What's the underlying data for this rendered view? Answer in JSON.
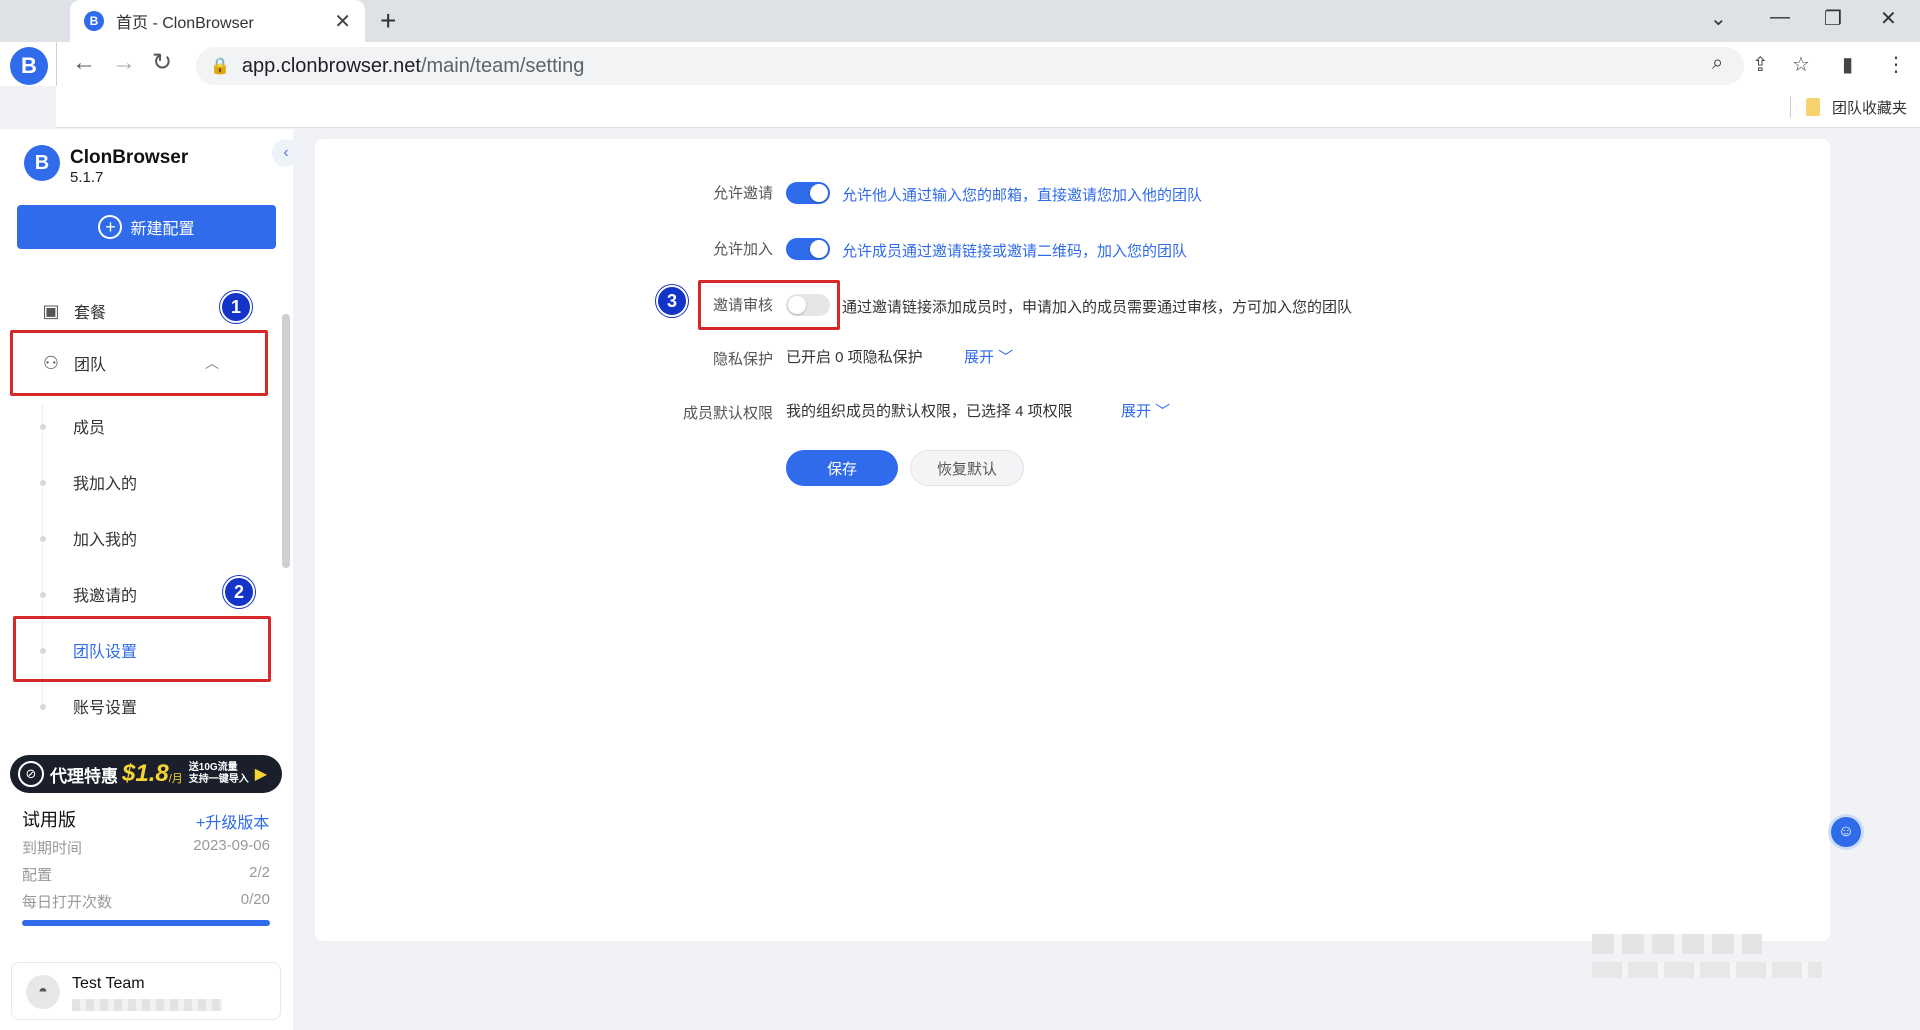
{
  "browser": {
    "tab_title": "首页 - ClonBrowser",
    "tab_close": "✕",
    "new_tab": "+",
    "url_host": "app.clonbrowser.net",
    "url_path": "/main/team/setting",
    "bookmark": "团队收藏夹"
  },
  "sidebar": {
    "brand": "ClonBrowser",
    "version": "5.1.7",
    "new_config": "新建配置",
    "items": {
      "plan": "套餐",
      "team": "团队"
    },
    "team_children": [
      "成员",
      "我加入的",
      "加入我的",
      "我邀请的",
      "团队设置",
      "账号设置"
    ],
    "promo": {
      "label": "代理特惠",
      "price": "$1.8",
      "unit": "/月",
      "sub1": "送10G流量",
      "sub2": "支持一键导入"
    },
    "plan_info": {
      "title": "试用版",
      "upgrade": "+升级版本",
      "rows": [
        {
          "label": "到期时间",
          "value": "2023-09-06"
        },
        {
          "label": "配置",
          "value": "2/2"
        },
        {
          "label": "每日打开次数",
          "value": "0/20"
        }
      ],
      "progress": 1.0
    },
    "account_name": "Test Team"
  },
  "annotations": [
    "1",
    "2",
    "3"
  ],
  "settings": {
    "allow_invite": {
      "label": "允许邀请",
      "enabled": true,
      "desc": "允许他人通过输入您的邮箱，直接邀请您加入他的团队"
    },
    "allow_join": {
      "label": "允许加入",
      "enabled": true,
      "desc": "允许成员通过邀请链接或邀请二维码，加入您的团队"
    },
    "invite_review": {
      "label": "邀请审核",
      "enabled": false,
      "desc": "通过邀请链接添加成员时，申请加入的成员需要通过审核，方可加入您的团队"
    },
    "privacy": {
      "label": "隐私保护",
      "desc": "已开启 0 项隐私保护",
      "expand": "展开"
    },
    "default_perms": {
      "label": "成员默认权限",
      "desc": "我的组织成员的默认权限，已选择 4 项权限",
      "expand": "展开"
    },
    "save": "保存",
    "reset": "恢复默认"
  },
  "colors": {
    "accent": "#2f6bea",
    "highlight": "#d62828",
    "badge": "#1433c9"
  }
}
